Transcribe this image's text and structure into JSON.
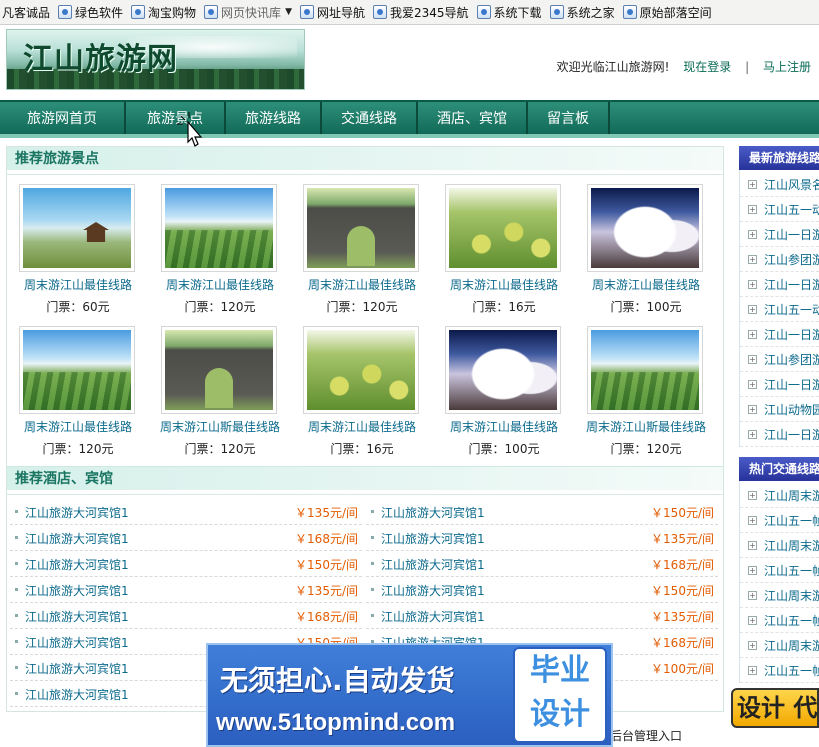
{
  "browser": {
    "favorites": [
      {
        "label": "凡客诚品",
        "icon": "page-icon"
      },
      {
        "label": "绿色软件",
        "icon": "page-icon"
      },
      {
        "label": "淘宝购物",
        "icon": "page-icon"
      },
      {
        "label": "网页快讯库",
        "icon": "page-icon",
        "dropdown": true
      },
      {
        "label": "网址导航",
        "icon": "page-icon"
      },
      {
        "label": "我爱2345导航",
        "icon": "page-icon"
      },
      {
        "label": "系统下载",
        "icon": "page-icon"
      },
      {
        "label": "系统之家",
        "icon": "page-icon"
      },
      {
        "label": "原始部落空间",
        "icon": "page-icon"
      }
    ]
  },
  "header": {
    "logo_text": "江山旅游网",
    "welcome": "欢迎光临江山旅游网!",
    "login": "现在登录",
    "separator": "|",
    "register": "马上注册"
  },
  "nav": [
    {
      "label": "旅游网首页"
    },
    {
      "label": "旅游景点"
    },
    {
      "label": "旅游线路"
    },
    {
      "label": "交通线路"
    },
    {
      "label": "酒店、宾馆"
    },
    {
      "label": "留言板"
    }
  ],
  "spots": {
    "title": "推荐旅游景点",
    "items": [
      {
        "name": "周末游江山最佳线路",
        "price": "门票：60元",
        "image": "lake"
      },
      {
        "name": "周末游江山最佳线路",
        "price": "门票：120元",
        "image": "field"
      },
      {
        "name": "周末游江山最佳线路",
        "price": "门票：120元",
        "image": "gate"
      },
      {
        "name": "周末游江山最佳线路",
        "price": "门票：16元",
        "image": "pear"
      },
      {
        "name": "周末游江山最佳线路",
        "price": "门票：100元",
        "image": "clouds"
      },
      {
        "name": "周末游江山最佳线路",
        "price": "门票：120元",
        "image": "field"
      },
      {
        "name": "周末游江山斯最佳线路",
        "price": "门票：120元",
        "image": "gate"
      },
      {
        "name": "周末游江山最佳线路",
        "price": "门票：16元",
        "image": "pear"
      },
      {
        "name": "周末游江山最佳线路",
        "price": "门票：100元",
        "image": "clouds"
      },
      {
        "name": "周末游江山斯最佳线路",
        "price": "门票：120元",
        "image": "field"
      }
    ]
  },
  "hotels": {
    "title": "推荐酒店、宾馆",
    "rows": [
      {
        "left": {
          "name": "江山旅游大河宾馆1",
          "price": "￥135元/间"
        },
        "right": {
          "name": "江山旅游大河宾馆1",
          "price": "￥150元/间"
        }
      },
      {
        "left": {
          "name": "江山旅游大河宾馆1",
          "price": "￥168元/间"
        },
        "right": {
          "name": "江山旅游大河宾馆1",
          "price": "￥135元/间"
        }
      },
      {
        "left": {
          "name": "江山旅游大河宾馆1",
          "price": "￥150元/间"
        },
        "right": {
          "name": "江山旅游大河宾馆1",
          "price": "￥168元/间"
        }
      },
      {
        "left": {
          "name": "江山旅游大河宾馆1",
          "price": "￥135元/间"
        },
        "right": {
          "name": "江山旅游大河宾馆1",
          "price": "￥150元/间"
        }
      },
      {
        "left": {
          "name": "江山旅游大河宾馆1",
          "price": "￥168元/间"
        },
        "right": {
          "name": "江山旅游大河宾馆1",
          "price": "￥135元/间"
        }
      },
      {
        "left": {
          "name": "江山旅游大河宾馆1",
          "price": "￥150元/间"
        },
        "right": {
          "name": "江山旅游大河宾馆1",
          "price": "￥168元/间"
        }
      },
      {
        "left": {
          "name": "江山旅游大河宾馆1",
          "price": ""
        },
        "right": {
          "name": "",
          "price": "￥100元/间"
        }
      },
      {
        "left": {
          "name": "江山旅游大河宾馆1",
          "price": ""
        },
        "right": {
          "name": "",
          "price": ""
        }
      }
    ]
  },
  "sidebar": {
    "routes_title": "最新旅游线路",
    "routes": [
      "江山风景名",
      "江山五一动",
      "江山一日游",
      "江山参团游",
      "江山一日游",
      "江山五一动",
      "江山一日游",
      "江山参团游",
      "江山一日游",
      "江山动物园",
      "江山一日游"
    ],
    "traffic_title": "热门交通线路",
    "traffic": [
      "江山周末游",
      "江山五一帧",
      "江山周末游",
      "江山五一帧",
      "江山周末游",
      "江山五一帧",
      "江山周末游",
      "江山五一帧"
    ]
  },
  "footer": {
    "admin_link": "后台管理入口"
  },
  "watermark": {
    "line1": "无须担心.自动发货",
    "line2": "www.51topmind.com",
    "badge1": "毕业",
    "badge2": "设计",
    "corner": "设计 代"
  },
  "colors": {
    "nav": "#116a57",
    "link": "#0c6a8c",
    "price": "#e35b00",
    "sidebar_title": "#27329a"
  }
}
